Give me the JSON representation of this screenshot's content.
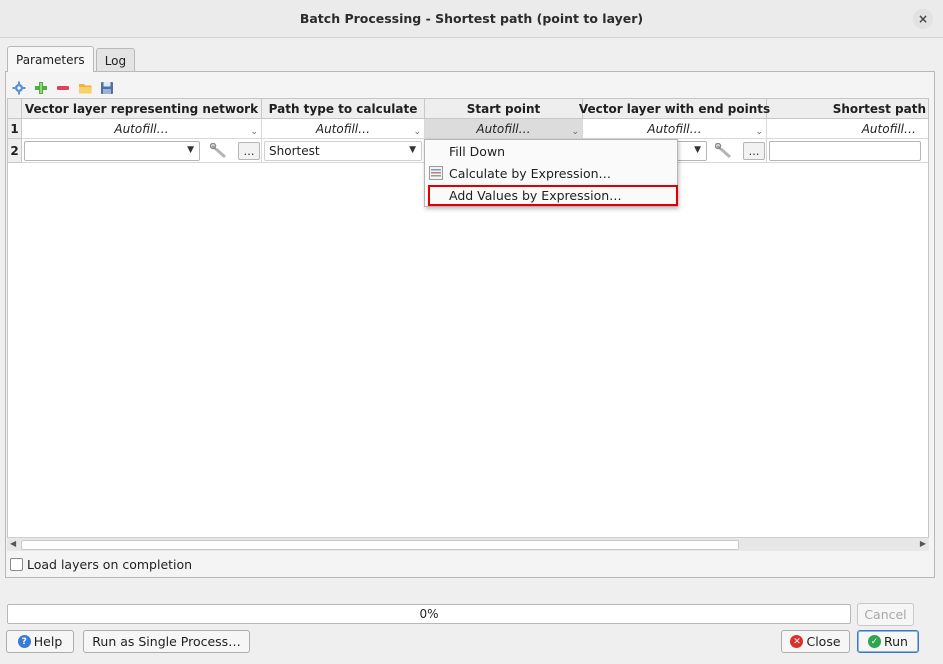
{
  "window": {
    "title": "Batch Processing - Shortest path (point to layer)",
    "close_glyph": "×"
  },
  "tabs": [
    {
      "label": "Parameters",
      "active": true
    },
    {
      "label": "Log",
      "active": false
    }
  ],
  "toolbar": {
    "icons": [
      "autofill-gear-icon",
      "add-row-icon",
      "remove-row-icon",
      "open-file-icon",
      "save-file-icon"
    ]
  },
  "table": {
    "columns": [
      "Vector layer representing network",
      "Path type to calculate",
      "Start point",
      "Vector layer with end points",
      "Shortest path"
    ],
    "row1": {
      "number": "1",
      "cells": [
        "Autofill…",
        "Autofill…",
        "Autofill…",
        "Autofill…",
        "Autofill…"
      ]
    },
    "row2": {
      "number": "2",
      "network_layer": "",
      "path_type": "Shortest",
      "dots": "…",
      "end_points_layer": "",
      "shortest_path": ""
    }
  },
  "context_menu": {
    "items": [
      "Fill Down",
      "Calculate by Expression…",
      "Add Values by Expression…"
    ],
    "highlight_color": "#e00000"
  },
  "load_layers": {
    "label": "Load layers on completion",
    "checked": false
  },
  "progress": {
    "text": "0%",
    "value": 0
  },
  "buttons": {
    "cancel": "Cancel",
    "help": "Help",
    "run_single": "Run as Single Process…",
    "close": "Close",
    "run": "Run"
  },
  "colors": {
    "accent_green": "#2da44e",
    "close_red": "#d9302c",
    "help_blue": "#3a7bd5"
  }
}
